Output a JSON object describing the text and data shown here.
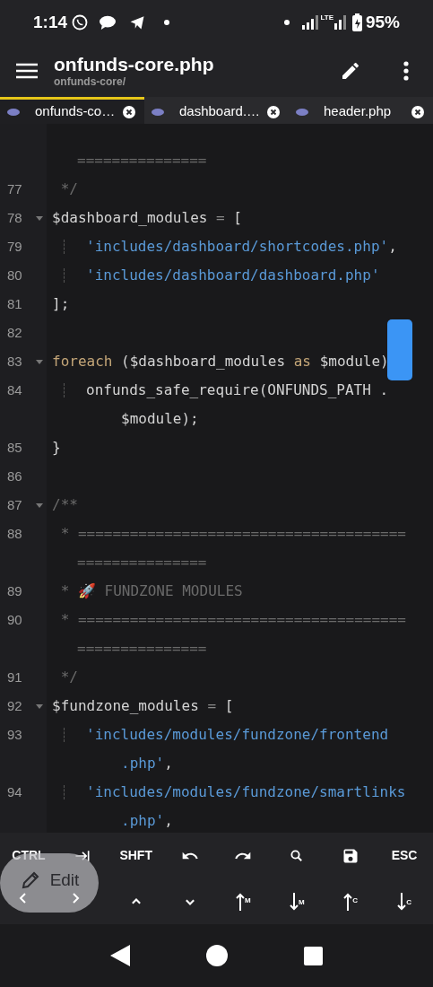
{
  "status_bar": {
    "time": "1:14",
    "network": "LTE",
    "battery": "95%"
  },
  "app_bar": {
    "title": "onfunds-core.php",
    "subtitle": "onfunds-core/"
  },
  "tabs": [
    {
      "label": "onfunds-co…",
      "selected": true
    },
    {
      "label": "dashboard.…",
      "selected": false
    },
    {
      "label": "header.php",
      "selected": false
    }
  ],
  "code_lines": [
    {
      "rows": [
        [
          {
            "kind": "comment",
            "text": "==============="
          }
        ]
      ],
      "wrapped": true
    },
    {
      "number": "77",
      "rows": [
        [
          {
            "kind": "comment",
            "text": " */"
          }
        ]
      ]
    },
    {
      "number": "78",
      "fold": true,
      "rows": [
        [
          {
            "kind": "var",
            "text": "$dashboard_modules"
          },
          {
            "kind": "op",
            "text": " = "
          },
          {
            "kind": "plain",
            "text": "["
          }
        ]
      ]
    },
    {
      "number": "79",
      "guide": true,
      "rows": [
        [
          {
            "kind": "str",
            "text": "'includes/dashboard/shortcodes.php'"
          },
          {
            "kind": "plain",
            "text": ","
          }
        ]
      ]
    },
    {
      "number": "80",
      "guide": true,
      "rows": [
        [
          {
            "kind": "str",
            "text": "'includes/dashboard/dashboard.php'"
          }
        ]
      ]
    },
    {
      "number": "81",
      "rows": [
        [
          {
            "kind": "plain",
            "text": "];"
          }
        ]
      ]
    },
    {
      "number": "82",
      "rows": [
        []
      ]
    },
    {
      "number": "83",
      "fold": true,
      "rows": [
        [
          {
            "kind": "kw",
            "text": "foreach"
          },
          {
            "kind": "plain",
            "text": " ($dashboard_modules "
          },
          {
            "kind": "kw",
            "text": "as"
          },
          {
            "kind": "plain",
            "text": " $module)"
          }
        ]
      ]
    },
    {
      "number": "84",
      "guide": true,
      "rows": [
        [
          {
            "kind": "plain",
            "text": "onfunds_safe_require(ONFUNDS_PATH ."
          }
        ],
        [
          {
            "kind": "plain",
            "text": "$module);"
          }
        ]
      ]
    },
    {
      "number": "85",
      "rows": [
        [
          {
            "kind": "plain",
            "text": "}"
          }
        ]
      ]
    },
    {
      "number": "86",
      "rows": [
        []
      ]
    },
    {
      "number": "87",
      "fold": true,
      "rows": [
        [
          {
            "kind": "comment",
            "text": "/**"
          }
        ]
      ]
    },
    {
      "number": "88",
      "rows": [
        [
          {
            "kind": "comment",
            "text": " * ======================================"
          }
        ],
        [
          {
            "kind": "comment",
            "text": "==============="
          }
        ]
      ]
    },
    {
      "number": "89",
      "rows": [
        [
          {
            "kind": "comment",
            "text": " * 🚀 FUNDZONE MODULES"
          }
        ]
      ]
    },
    {
      "number": "90",
      "rows": [
        [
          {
            "kind": "comment",
            "text": " * ======================================"
          }
        ],
        [
          {
            "kind": "comment",
            "text": "==============="
          }
        ]
      ]
    },
    {
      "number": "91",
      "rows": [
        [
          {
            "kind": "comment",
            "text": " */"
          }
        ]
      ]
    },
    {
      "number": "92",
      "fold": true,
      "rows": [
        [
          {
            "kind": "var",
            "text": "$fundzone_modules"
          },
          {
            "kind": "op",
            "text": " = "
          },
          {
            "kind": "plain",
            "text": "["
          }
        ]
      ]
    },
    {
      "number": "93",
      "guide": true,
      "rows": [
        [
          {
            "kind": "str",
            "text": "'includes/modules/fundzone/frontend"
          }
        ],
        [
          {
            "kind": "str",
            "text": ".php'"
          },
          {
            "kind": "plain",
            "text": ","
          }
        ]
      ]
    },
    {
      "number": "94",
      "guide": true,
      "rows": [
        [
          {
            "kind": "str",
            "text": "'includes/modules/fundzone/smartlinks"
          }
        ],
        [
          {
            "kind": "str",
            "text": ".php'"
          },
          {
            "kind": "plain",
            "text": ","
          }
        ]
      ]
    }
  ],
  "keys_row_1": [
    {
      "kind": "text",
      "label": "CTRL"
    },
    {
      "kind": "tab"
    },
    {
      "kind": "text",
      "label": "SHFT"
    },
    {
      "kind": "undo"
    },
    {
      "kind": "redo"
    },
    {
      "kind": "search"
    },
    {
      "kind": "save"
    },
    {
      "kind": "text",
      "label": "ESC"
    }
  ],
  "keys_row_2": [
    {
      "kind": "up"
    },
    {
      "kind": "down"
    },
    {
      "kind": "move-up",
      "sub": "M"
    },
    {
      "kind": "move-down",
      "sub": "M"
    },
    {
      "kind": "move-up",
      "sub": "C"
    },
    {
      "kind": "move-down",
      "sub": "C"
    }
  ],
  "edit_button": {
    "label": "Edit"
  }
}
